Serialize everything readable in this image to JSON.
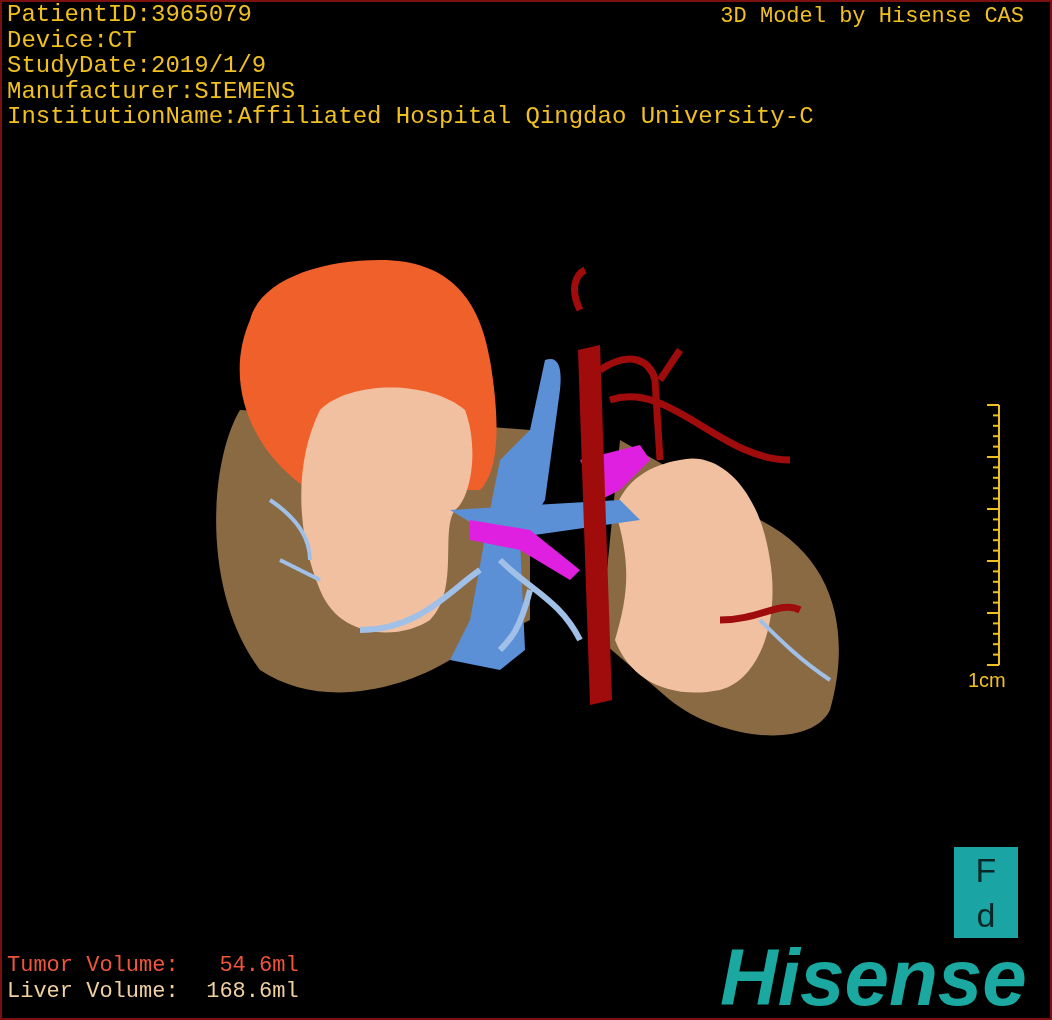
{
  "header": {
    "lines": [
      "PatientID:3965079",
      "Device:CT",
      "StudyDate:2019/1/9",
      "Manufacturer:SIEMENS",
      "InstitutionName:Affiliated Hospital Qingdao University-C"
    ]
  },
  "credit": "3D Model by Hisense CAS",
  "scale_bar": {
    "label": "1cm"
  },
  "orientation_cube": {
    "top": "F",
    "bottom": "d"
  },
  "volumes": [
    {
      "kind": "tumor",
      "label": "Tumor Volume:",
      "value": "54.6ml"
    },
    {
      "kind": "liver",
      "label": "Liver Volume:",
      "value": "168.6ml"
    }
  ],
  "logo": "Hisense"
}
